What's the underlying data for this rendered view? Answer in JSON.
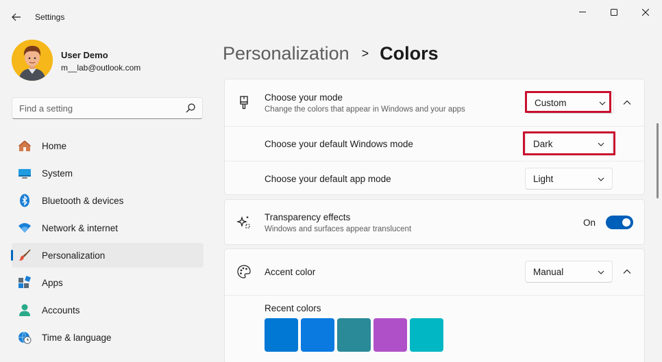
{
  "window": {
    "title": "Settings"
  },
  "profile": {
    "name": "User Demo",
    "email": "m__lab@outlook.com"
  },
  "search": {
    "placeholder": "Find a setting"
  },
  "sidebar": {
    "items": [
      {
        "label": "Home",
        "icon": "home-icon",
        "active": false
      },
      {
        "label": "System",
        "icon": "system-icon",
        "active": false
      },
      {
        "label": "Bluetooth & devices",
        "icon": "bluetooth-icon",
        "active": false
      },
      {
        "label": "Network & internet",
        "icon": "wifi-icon",
        "active": false
      },
      {
        "label": "Personalization",
        "icon": "brush-icon",
        "active": true
      },
      {
        "label": "Apps",
        "icon": "apps-icon",
        "active": false
      },
      {
        "label": "Accounts",
        "icon": "account-icon",
        "active": false
      },
      {
        "label": "Time & language",
        "icon": "clock-globe-icon",
        "active": false
      }
    ]
  },
  "breadcrumb": {
    "parent": "Personalization",
    "separator": ">",
    "current": "Colors"
  },
  "mode": {
    "title": "Choose your mode",
    "subtitle": "Change the colors that appear in Windows and your apps",
    "value": "Custom",
    "windows_mode": {
      "label": "Choose your default Windows mode",
      "value": "Dark"
    },
    "app_mode": {
      "label": "Choose your default app mode",
      "value": "Light"
    }
  },
  "transparency": {
    "title": "Transparency effects",
    "subtitle": "Windows and surfaces appear translucent",
    "state_label": "On",
    "enabled": true
  },
  "accent": {
    "title": "Accent color",
    "value": "Manual",
    "recent_label": "Recent colors",
    "recent_colors": [
      "#0078d4",
      "#0a7ae0",
      "#2a8a98",
      "#b050c8",
      "#00b7c3"
    ]
  },
  "colors": {
    "accent": "#005fb8",
    "highlight_box": "#c8102e",
    "nav_indicator": "#0067c0"
  }
}
